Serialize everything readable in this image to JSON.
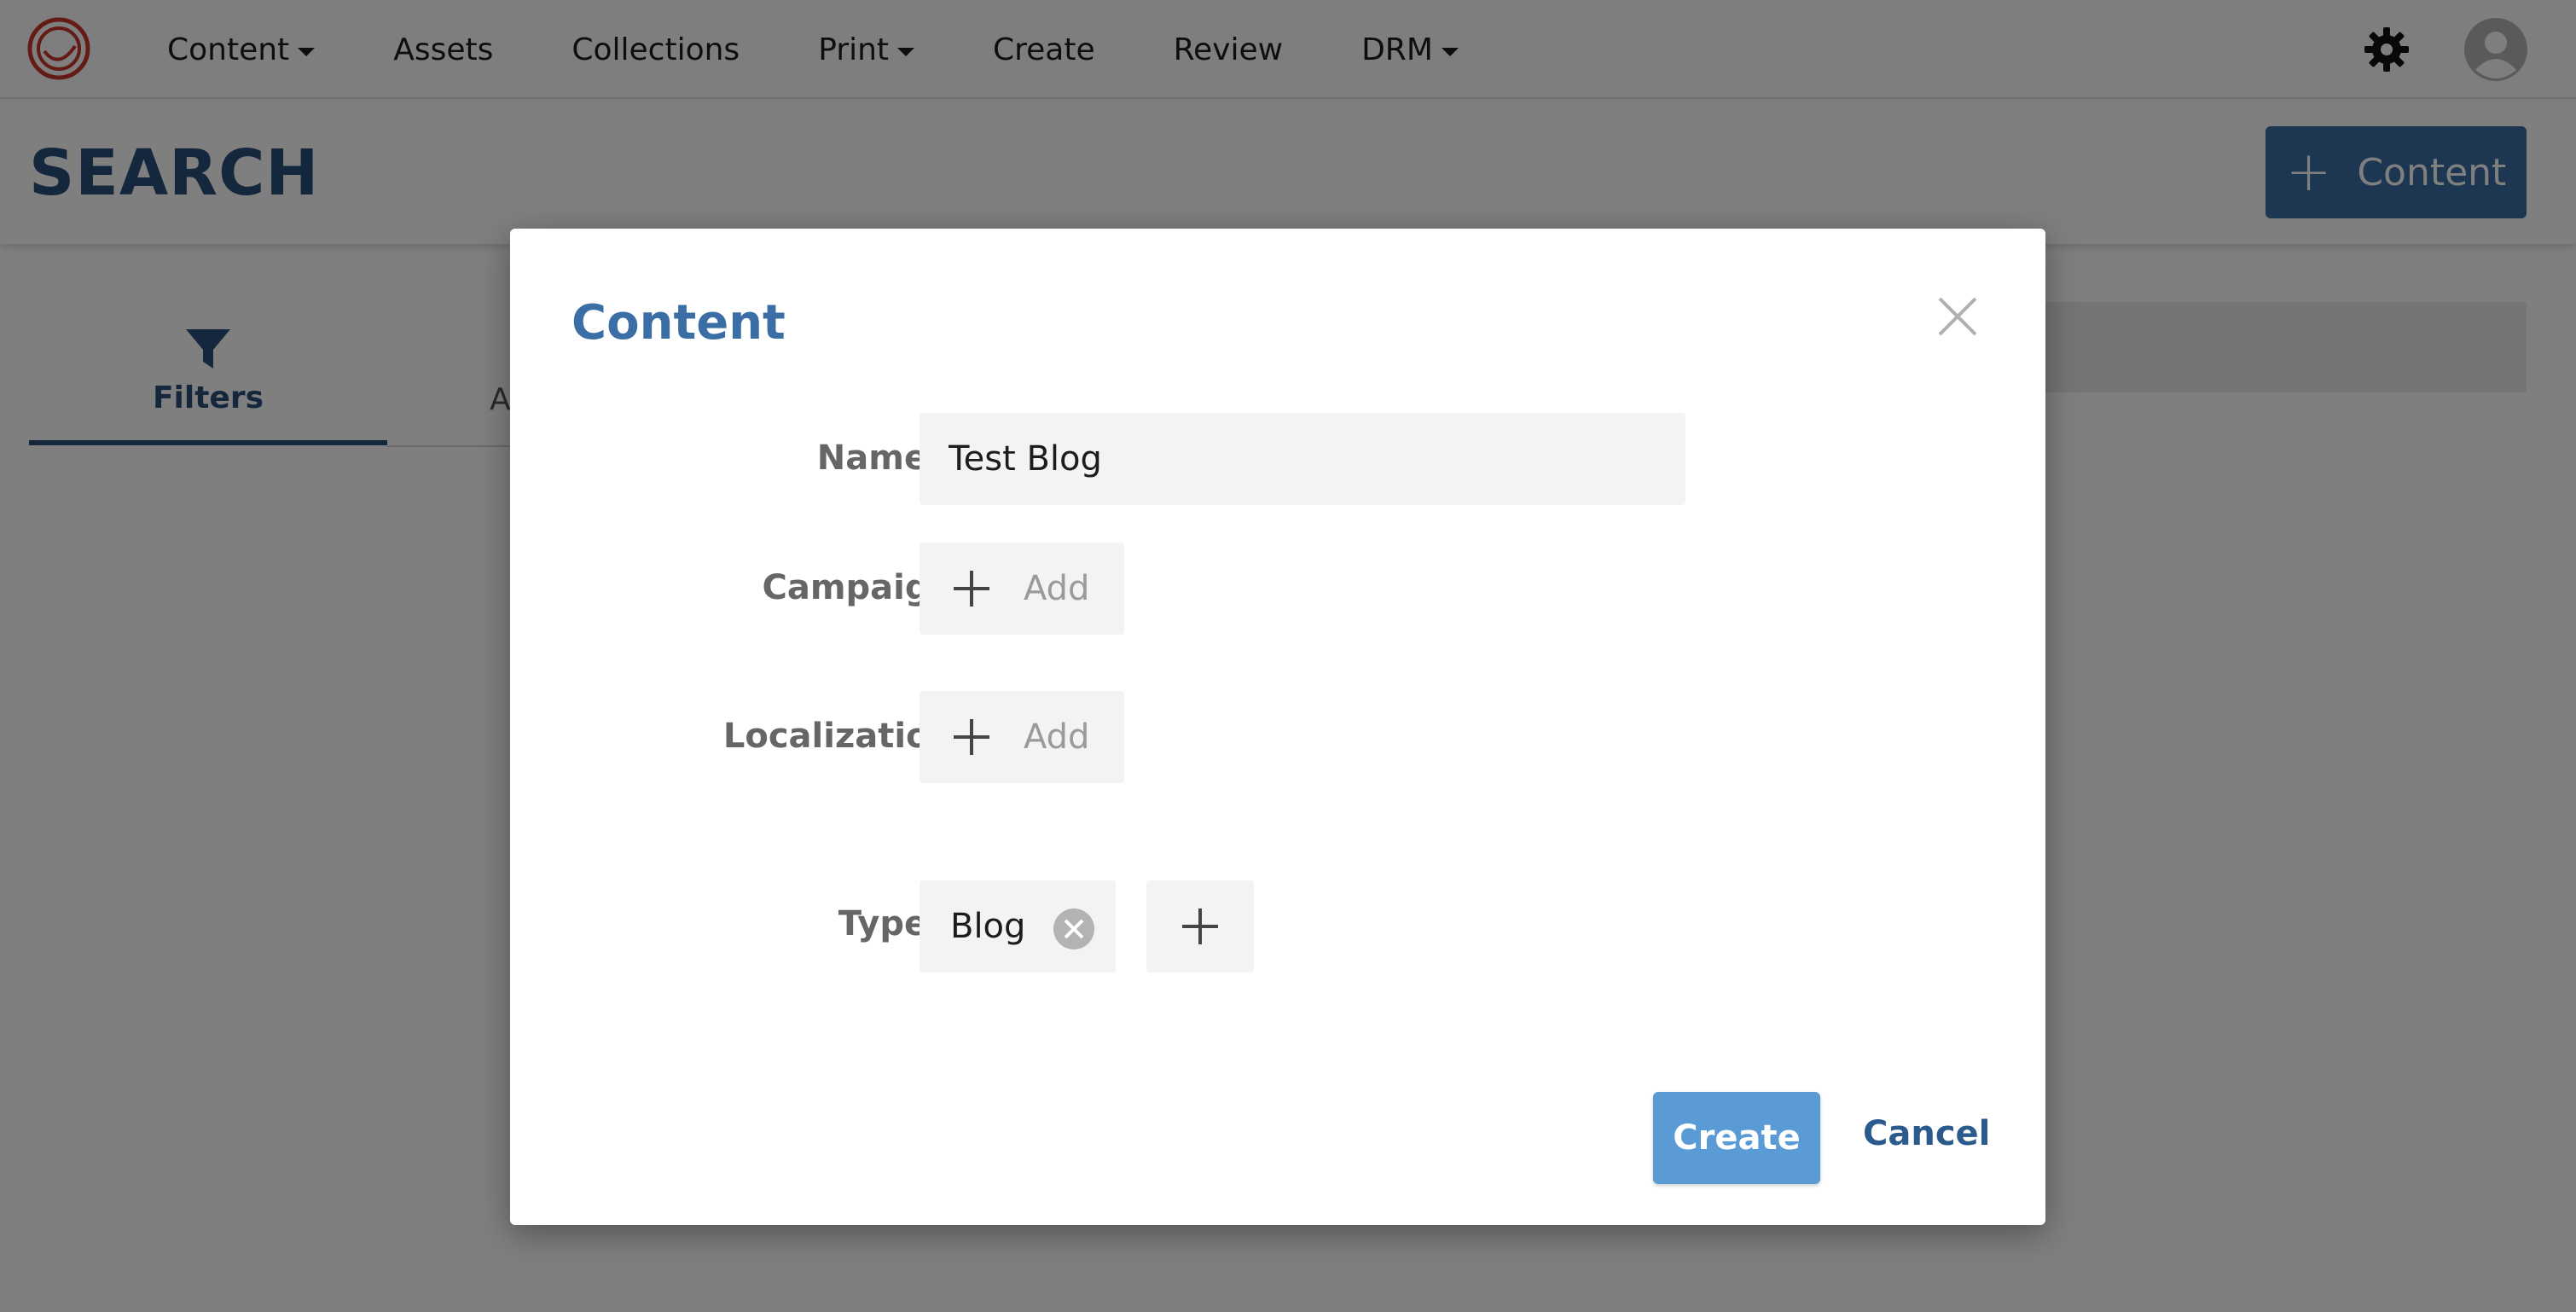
{
  "nav": {
    "items": [
      {
        "label": "Content",
        "has_caret": true
      },
      {
        "label": "Assets",
        "has_caret": false
      },
      {
        "label": "Collections",
        "has_caret": false
      },
      {
        "label": "Print",
        "has_caret": true
      },
      {
        "label": "Create",
        "has_caret": false
      },
      {
        "label": "Review",
        "has_caret": false
      },
      {
        "label": "DRM",
        "has_caret": true
      }
    ],
    "icons": [
      "logo-icon",
      "gear-icon",
      "user-avatar-icon"
    ]
  },
  "header": {
    "title": "SEARCH",
    "add_button_label": "Content"
  },
  "sidebar": {
    "filters_tab_label": "Filters",
    "second_tab_label": "A"
  },
  "modal": {
    "title": "Content",
    "fields": {
      "name_label": "Name",
      "name_value": "Test Blog",
      "campaign_label": "Campaign",
      "campaign_add_label": "Add",
      "localization_label": "Localization",
      "localization_add_label": "Add",
      "type_label": "Type",
      "type_value": "Blog"
    },
    "required_marker": "*",
    "create_label": "Create",
    "cancel_label": "Cancel"
  },
  "colors": {
    "brand_blue": "#3b6ea5",
    "title_blue": "#2b4f7a",
    "required_red": "#d2322d",
    "create_blue": "#5b9bd5"
  }
}
